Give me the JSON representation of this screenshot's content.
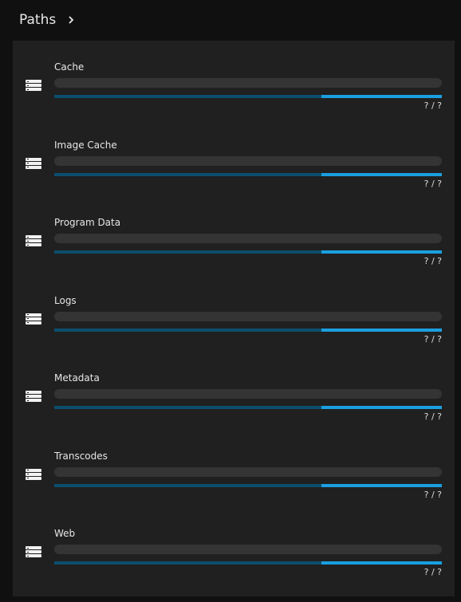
{
  "header": {
    "title": "Paths",
    "chevron_icon": "chevron-right-icon"
  },
  "colors": {
    "bar_track": "#0c4e6e",
    "bar_fill": "#1a9fe0",
    "panel_bg": "#202020",
    "page_bg": "#101010"
  },
  "paths": [
    {
      "label": "Cache",
      "usage": "? / ?",
      "unused_fraction": 0.31,
      "icon": "storage-icon"
    },
    {
      "label": "Image Cache",
      "usage": "? / ?",
      "unused_fraction": 0.31,
      "icon": "storage-icon"
    },
    {
      "label": "Program Data",
      "usage": "? / ?",
      "unused_fraction": 0.31,
      "icon": "storage-icon"
    },
    {
      "label": "Logs",
      "usage": "? / ?",
      "unused_fraction": 0.31,
      "icon": "storage-icon"
    },
    {
      "label": "Metadata",
      "usage": "? / ?",
      "unused_fraction": 0.31,
      "icon": "storage-icon"
    },
    {
      "label": "Transcodes",
      "usage": "? / ?",
      "unused_fraction": 0.31,
      "icon": "storage-icon"
    },
    {
      "label": "Web",
      "usage": "? / ?",
      "unused_fraction": 0.31,
      "icon": "storage-icon"
    }
  ]
}
